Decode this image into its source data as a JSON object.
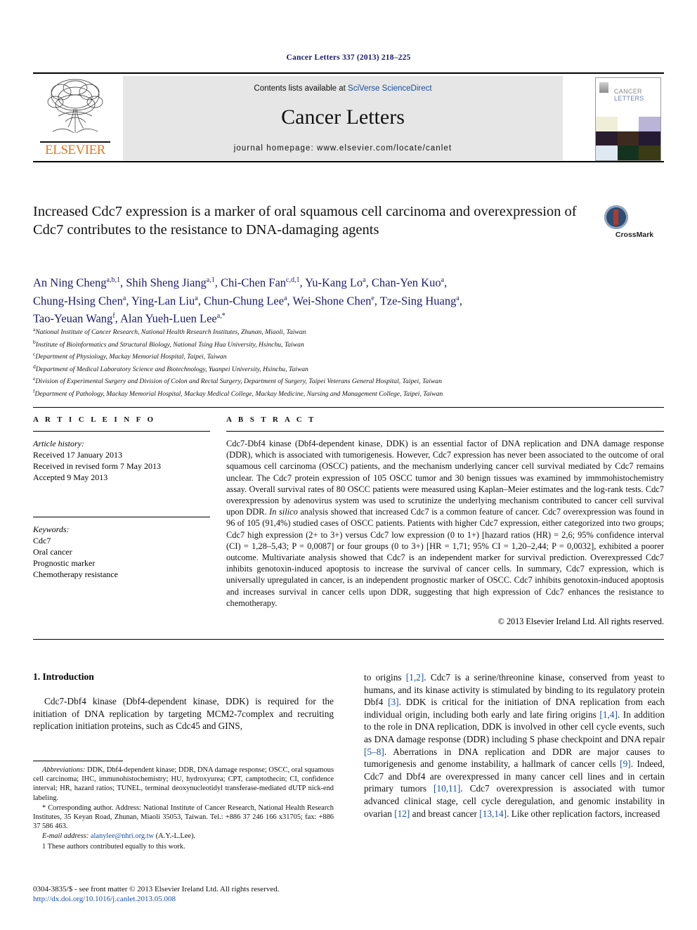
{
  "running_head": "Cancer Letters 337 (2013) 218–225",
  "masthead": {
    "contents_prefix": "Contents lists available at ",
    "sciencedirect_link": "SciVerse ScienceDirect",
    "journal_name": "Cancer Letters",
    "homepage": "journal homepage: www.elsevier.com/locate/canlet",
    "publisher_logo_text": "ELSEVIER",
    "cover_line1": "CANCER",
    "cover_line2": "LETTERS"
  },
  "crossmark": {
    "label": "CrossMark"
  },
  "article": {
    "title": "Increased Cdc7 expression is a marker of oral squamous cell carcinoma and overexpression of Cdc7 contributes to the resistance to DNA-damaging agents",
    "authors_line1": "An Ning Cheng a,b,1, Shih Sheng Jiang a,1, Chi-Chen Fan c,d,1, Yu-Kang Lo a, Chan-Yen Kuo a,",
    "authors_line2": "Chung-Hsing Chen a, Ying-Lan Liu a, Chun-Chung Lee a, Wei-Shone Chen e, Tze-Sing Huang a,",
    "authors_line3": "Tao-Yeuan Wang f, Alan Yueh-Luen Lee a,*",
    "affiliations": [
      {
        "marker": "a",
        "text": "National Institute of Cancer Research, National Health Research Institutes, Zhunan, Miaoli, Taiwan"
      },
      {
        "marker": "b",
        "text": "Institute of Bioinformatics and Structural Biology, National Tsing Hua University, Hsinchu, Taiwan"
      },
      {
        "marker": "c",
        "text": "Department of Physiology, Mackay Memorial Hospital, Taipei, Taiwan"
      },
      {
        "marker": "d",
        "text": "Department of Medical Laboratory Science and Biotechnology, Yuanpei University, Hsinchu, Taiwan"
      },
      {
        "marker": "e",
        "text": "Division of Experimental Surgery and Division of Colon and Rectal Surgery, Department of Surgery, Taipei Veterans General Hospital, Taipei, Taiwan"
      },
      {
        "marker": "f",
        "text": "Department of Pathology, Mackay Memorial Hospital, Mackay Medical College, Mackay Medicine, Nursing and Management College, Taipei, Taiwan"
      }
    ]
  },
  "article_info": {
    "heading": "A R T I C L E  I N F O",
    "history_label": "Article history:",
    "history": [
      "Received 17 January 2013",
      "Received in revised form 7 May 2013",
      "Accepted 9 May 2013"
    ],
    "keywords_label": "Keywords:",
    "keywords": [
      "Cdc7",
      "Oral cancer",
      "Prognostic marker",
      "Chemotherapy resistance"
    ]
  },
  "abstract": {
    "heading": "A B S T R A C T",
    "paragraph_a": "Cdc7-Dbf4 kinase (Dbf4-dependent kinase, DDK) is an essential factor of DNA replication and DNA damage response (DDR), which is associated with tumorigenesis. However, Cdc7 expression has never been associated to the outcome of oral squamous cell carcinoma (OSCC) patients, and the mechanism underlying cancer cell survival mediated by Cdc7 remains unclear. The Cdc7 protein expression of 105 OSCC tumor and 30 benign tissues was examined by immmohistochemistry assay. Overall survival rates of 80 OSCC patients were measured using Kaplan–Meier estimates and the log-rank tests. Cdc7 overexpression by adenovirus system was used to scrutinize the underlying mechanism contributed to cancer cell survival upon DDR. ",
    "in_silico": "In silico",
    "paragraph_b": " analysis showed that increased Cdc7 is a common feature of cancer. Cdc7 overexpression was found in 96 of 105 (91,4%) studied cases of OSCC patients. Patients with higher Cdc7 expression, either categorized into two groups; Cdc7 high expression (2+ to 3+) versus Cdc7 low expression (0 to 1+) [hazard ratios (HR) = 2,6; 95% confidence interval (CI) = 1,28–5,43; P = 0,0087] or four groups (0 to 3+) [HR = 1,71; 95% CI = 1,20–2,44; P = 0,0032], exhibited a poorer outcome. Multivariate analysis showed that Cdc7 is an independent marker for survival prediction. Overexpressed Cdc7 inhibits genotoxin-induced apoptosis to increase the survival of cancer cells. In summary, Cdc7 expression, which is universally upregulated in cancer, is an independent prognostic marker of OSCC. Cdc7 inhibits genotoxin-induced apoptosis and increases survival in cancer cells upon DDR, suggesting that high expression of Cdc7 enhances the resistance to chemotherapy.",
    "copyright": "© 2013 Elsevier Ireland Ltd. All rights reserved."
  },
  "introduction": {
    "heading": "1. Introduction",
    "left_paragraph": "Cdc7-Dbf4 kinase (Dbf4-dependent kinase, DDK) is required for the initiation of DNA replication by targeting MCM2-7complex and recruiting replication initiation proteins, such as Cdc45 and GINS,",
    "right_segments": [
      {
        "text": "to origins ",
        "cite": false
      },
      {
        "text": "[1,2]",
        "cite": true
      },
      {
        "text": ". Cdc7 is a serine/threonine kinase, conserved from yeast to humans, and its kinase activity is stimulated by binding to its regulatory protein Dbf4 ",
        "cite": false
      },
      {
        "text": "[3]",
        "cite": true
      },
      {
        "text": ". DDK is critical for the initiation of DNA replication from each individual origin, including both early and late firing origins ",
        "cite": false
      },
      {
        "text": "[1,4]",
        "cite": true
      },
      {
        "text": ". In addition to the role in DNA replication, DDK is involved in other cell cycle events, such as DNA damage response (DDR) including S phase checkpoint and DNA repair ",
        "cite": false
      },
      {
        "text": "[5–8]",
        "cite": true
      },
      {
        "text": ". Aberrations in DNA replication and DDR are major causes to tumorigenesis and genome instability, a hallmark of cancer cells ",
        "cite": false
      },
      {
        "text": "[9]",
        "cite": true
      },
      {
        "text": ". Indeed, Cdc7 and Dbf4 are overexpressed in many cancer cell lines and in certain primary tumors ",
        "cite": false
      },
      {
        "text": "[10,11]",
        "cite": true
      },
      {
        "text": ". Cdc7 overexpression is associated with tumor advanced clinical stage, cell cycle deregulation, and genomic instability in ovarian ",
        "cite": false
      },
      {
        "text": "[12]",
        "cite": true
      },
      {
        "text": " and breast cancer ",
        "cite": false
      },
      {
        "text": "[13,14]",
        "cite": true
      },
      {
        "text": ". Like other replication factors, increased",
        "cite": false
      }
    ]
  },
  "footnotes": {
    "abbrev_label": "Abbreviations:",
    "abbrev_text": " DDK, Dbf4-dependent kinase; DDR, DNA damage response; OSCC, oral squamous cell carcinoma; IHC, immunohistochemistry; HU, hydroxyurea; CPT, camptothecin; CI, confidence interval; HR, hazard ratios; TUNEL, terminal deoxynucleotidyl transferase-mediated dUTP nick-end labeling.",
    "corresponding": "* Corresponding author. Address: National Institute of Cancer Research, National Health Research Institutes, 35 Keyan Road, Zhunan, Miaoli 35053, Taiwan. Tel.: +886 37 246 166 x31705; fax: +886 37 586 463.",
    "email_label": "E-mail address:",
    "email": "alanylee@nhri.org.tw",
    "email_suffix": " (A.Y.-L.Lee).",
    "equal_contrib": "1 These authors contributed equally to this work."
  },
  "imprint": {
    "line1": "0304-3835/$ - see front matter © 2013 Elsevier Ireland Ltd. All rights reserved.",
    "doi": "http://dx.doi.org/10.1016/j.canlet.2013.05.008"
  }
}
